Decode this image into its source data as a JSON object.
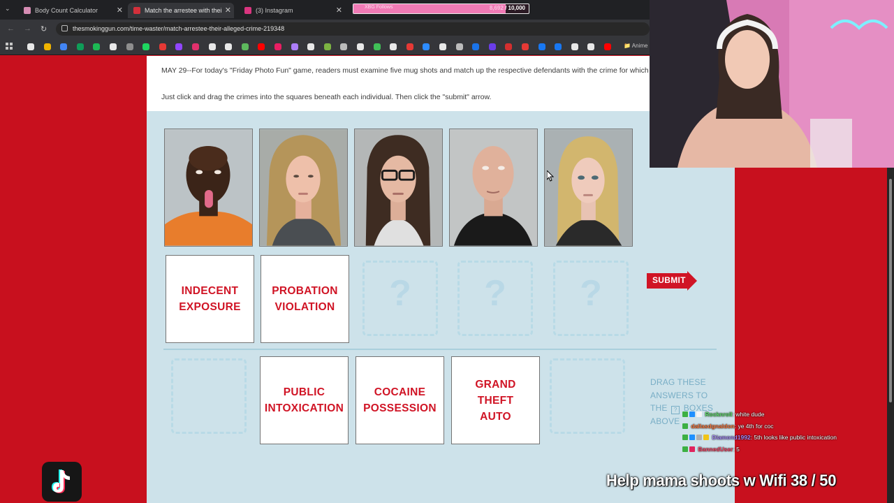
{
  "browser": {
    "tabs": [
      {
        "title": "Body Count Calculator",
        "active": false,
        "fav_color": "#d58cb3"
      },
      {
        "title": "Match the arrestee with their alleged crime",
        "active": true,
        "fav_color": "#d3303b"
      },
      {
        "title": "(3) Instagram",
        "active": false,
        "fav_color": "#d9357f"
      }
    ],
    "tab_close": "✕",
    "goal_widget": {
      "label": "XBG Follows",
      "current": "8,692",
      "max_label": "/ 10,000",
      "progress": 0.87
    },
    "url": "thesmokinggun.com/time-waster/match-arrestee-their-alleged-crime-219348",
    "bookmark_folder": "Anime",
    "bookmark_colors": [
      "#e8e8e8",
      "#f0b400",
      "#4285f4",
      "#0f9d58",
      "#1db954",
      "#e8e8e8",
      "#8e8e8e",
      "#1ed760",
      "#e53935",
      "#9146ff",
      "#e1306c",
      "#e8e8e8",
      "#e8e8e8",
      "#5db95d",
      "#ff0000",
      "#e91e63",
      "#ab7df8",
      "#e8e8e8",
      "#7cb342",
      "#bbbbbb",
      "#e8e8e8",
      "#40c057",
      "#e8e8e8",
      "#e53935",
      "#2d8cff",
      "#e8e8e8",
      "#bbbbbb",
      "#1a73e8",
      "#6a3de8",
      "#d32f2f",
      "#e53935",
      "#1877f2",
      "#1877f2",
      "#e8e8e8",
      "#e8e8e8",
      "#ff0000"
    ]
  },
  "page": {
    "intro_p1": "MAY 29--For today's \"Friday Photo Fun\" game, readers must examine five mug shots and match up the respective defendants with the crime for which they were arrested.",
    "intro_p2": "Just click and drag the crimes into the squares beneath each individual. Then click the \"submit\" arrow.",
    "placed_answers": [
      {
        "line1": "INDECENT",
        "line2": "EXPOSURE"
      },
      {
        "line1": "PROBATION",
        "line2": "VIOLATION"
      }
    ],
    "empty_slot_glyph": "?",
    "answer_pool": [
      {
        "line1": "PUBLIC",
        "line2": "INTOXICATION"
      },
      {
        "line1": "COCAINE",
        "line2": "POSSESSION"
      },
      {
        "line1": "GRAND",
        "line2": "THEFT",
        "line3": "AUTO"
      }
    ],
    "submit_label": "SUBMIT",
    "drag_hint_1": "DRAG THESE ANSWERS TO THE",
    "drag_hint_box": "?",
    "drag_hint_2": "BOXES ABOVE"
  },
  "stream": {
    "chat": [
      {
        "user": "Rocknroll",
        "user_color": "#5ee06a",
        "message": ": white dude",
        "badges": [
          "#3cb043",
          "#1e90ff",
          "#f5f5f5"
        ]
      },
      {
        "user": "dallasdgnaldon",
        "user_color": "#ff7a3d",
        "message": ": ye 4th for coc",
        "badges": [
          "#3cb043"
        ]
      },
      {
        "user": "Diamond1992",
        "user_color": "#a78bfa",
        "message": ": 5th looks like public intoxication",
        "badges": [
          "#3cb043",
          "#1e90ff",
          "#b0b0b0",
          "#f0c419"
        ]
      },
      {
        "user": "BannedUser",
        "user_color": "#ff4d6d",
        "message": ": 5",
        "badges": [
          "#3cb043",
          "#e0245e"
        ]
      }
    ],
    "banner": "Help mama shoots w Wifi  38 / 50"
  }
}
